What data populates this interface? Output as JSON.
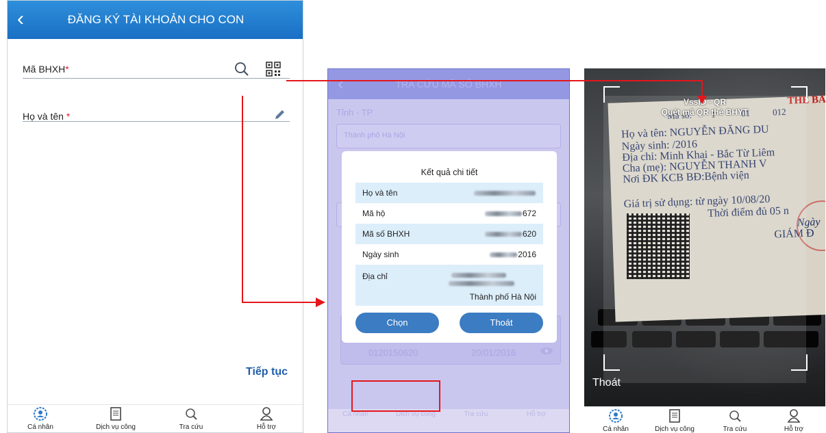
{
  "screen1": {
    "title": "ĐĂNG KÝ TÀI KHOẢN CHO CON",
    "back_icon": "chevron-left-icon",
    "field_bhxh_label": "Mã BHXH",
    "field_name_label": "Họ và tên",
    "required_mark": "*",
    "continue_label": "Tiếp tục",
    "nav": [
      "Cá nhân",
      "Dịch vụ công",
      "Tra cứu",
      "Hỗ trợ"
    ]
  },
  "screen2": {
    "title": "TRA CỨU MÃ SỐ BHXH",
    "province_label": "Tỉnh - TP",
    "province_value": "Thành phố Hà Nội",
    "ghost_bhxh": "0120150620",
    "ghost_dob": "20/01/2016",
    "dialog": {
      "title": "Kết quả chi tiết",
      "rows": [
        {
          "label": "Họ và tên",
          "value": ""
        },
        {
          "label": "Mã hộ",
          "value": "672"
        },
        {
          "label": "Mã số BHXH",
          "value": "620"
        },
        {
          "label": "Ngày sinh",
          "value": "2016"
        },
        {
          "label": "Địa chỉ",
          "value": "Thành phố Hà Nội"
        }
      ],
      "choose_label": "Chọn",
      "exit_label": "Thoát"
    },
    "nav": [
      "Cá nhân",
      "Dịch vụ công",
      "Tra cứu",
      "Hỗ trợ"
    ]
  },
  "screen3": {
    "title": "VssID - QR",
    "subtitle": "Quét mã QR thẻ BHYT",
    "exit_label": "Thoát",
    "card_lines": [
      "Họ và tên: NGUYỄN ĐĂNG DU",
      "Ngày sinh: /2016",
      "Địa chỉ: Minh Khai - Bắc Từ Liêm",
      "Cha (mẹ): NGUYỄN THANH V",
      "Nơi ĐK KCB BĐ:Bệnh viện",
      "Giá trị sử dụng: từ ngày 10/08/20",
      "Thời điểm đủ 05 n",
      "Ngày",
      "GIÁM Đ"
    ],
    "card_header": "THE BẢ",
    "card_number_label": "Mã số:",
    "card_numbers": [
      "1",
      "01",
      "012"
    ],
    "nav": [
      "Cá nhân",
      "Dịch vụ công",
      "Tra cứu",
      "Hỗ trợ"
    ]
  },
  "colors": {
    "header_blue": "#1a6fc4",
    "arrow_red": "#e4161a",
    "button_blue": "#3b7cc3"
  }
}
